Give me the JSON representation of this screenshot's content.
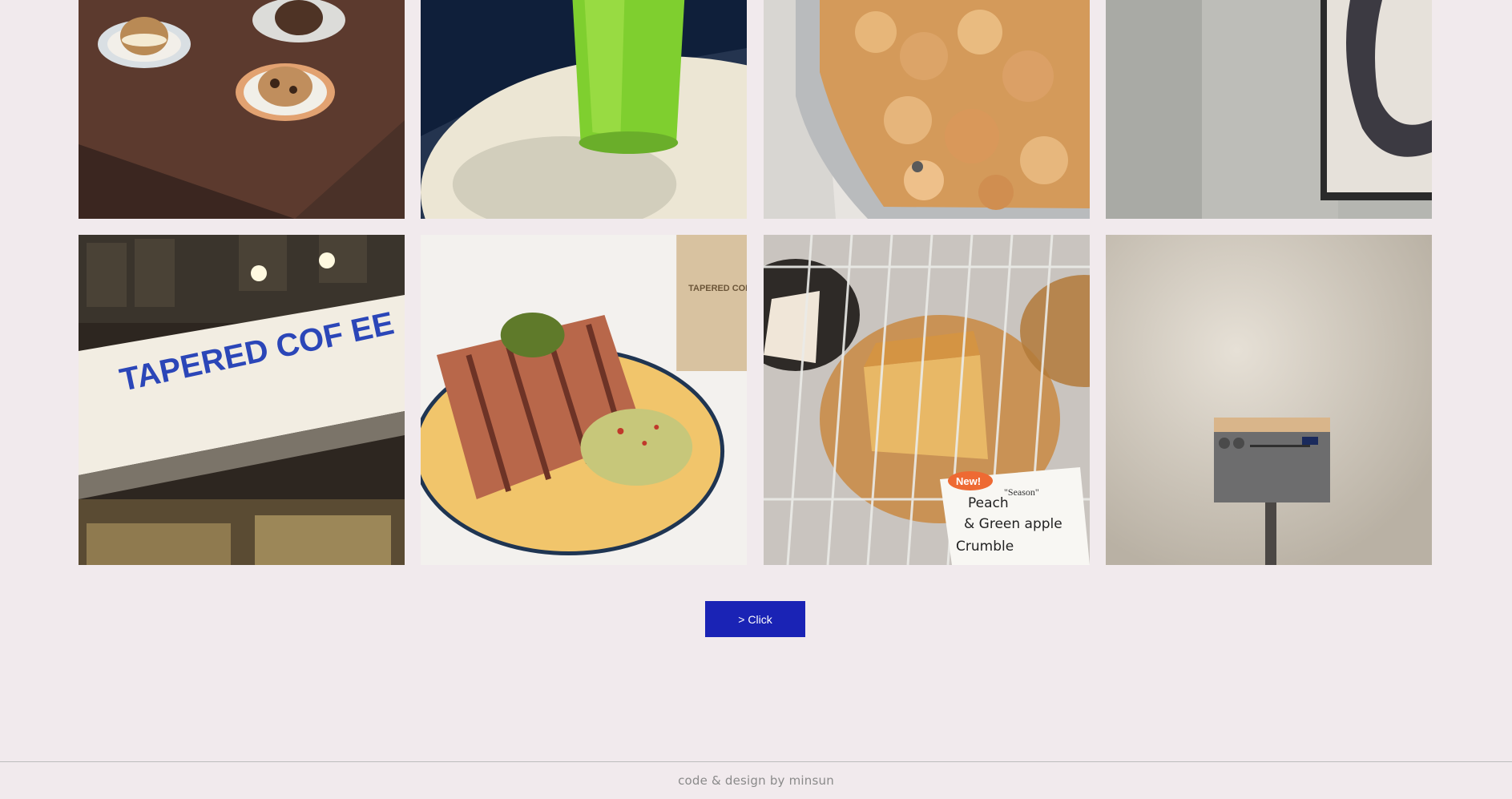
{
  "gallery": {
    "photos": [
      {
        "name": "photo-pastries-on-plates",
        "subject": "cream-filled scones on plates"
      },
      {
        "name": "photo-green-juice",
        "subject": "glass of green juice on white table"
      },
      {
        "name": "photo-baked-crumble",
        "subject": "baked crumble in a tray"
      },
      {
        "name": "photo-wall-art",
        "subject": "framed brush artwork on wall"
      },
      {
        "name": "photo-cafe-sign",
        "subject": "Tapered Coffee storefront sign"
      },
      {
        "name": "photo-panini-plate",
        "subject": "grilled panini with guacamole"
      },
      {
        "name": "photo-crumble-on-rack",
        "subject": "crumble slice on cooling rack with sign"
      },
      {
        "name": "photo-speaker-on-stand",
        "subject": "radio speaker on stand"
      }
    ],
    "sign_text": "TAPERED COF EE",
    "cup_text": "TAPERED COFFEE",
    "rack_sign_new": "New!",
    "rack_sign_lines": [
      "Peach",
      "& Green apple",
      "Crumble"
    ],
    "rack_sign_season": "\"Season\""
  },
  "more_button": {
    "label": "> Click"
  },
  "footer": {
    "credit": "code & design by minsun"
  },
  "colors": {
    "page_background": "#f1eaed",
    "button_background": "#1a23b5",
    "button_text": "#ffffff",
    "footer_text": "#8a8a8a"
  }
}
